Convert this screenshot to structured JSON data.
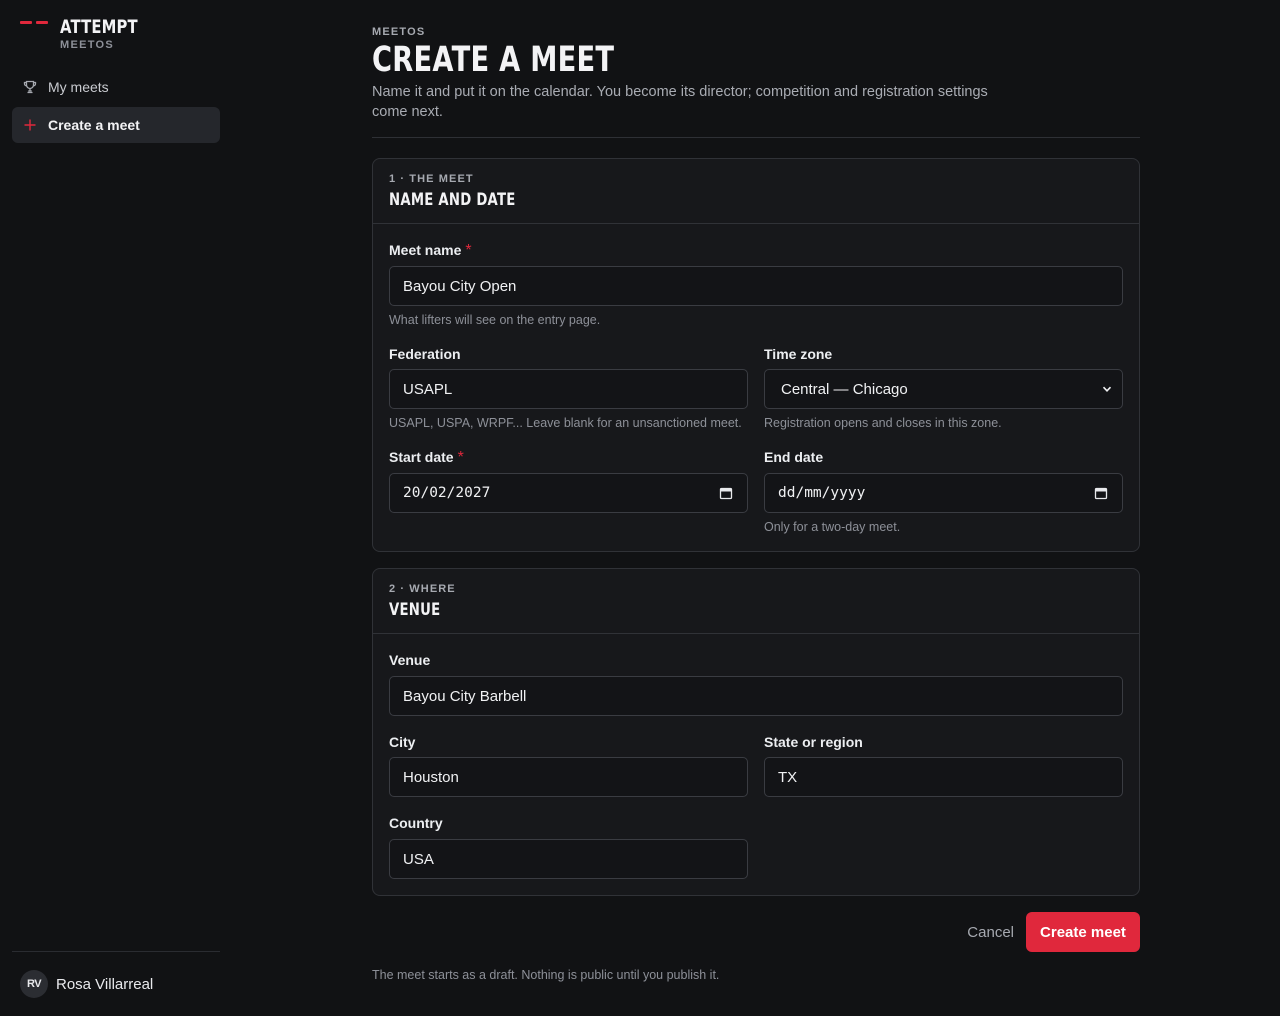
{
  "brand": {
    "name": "ATTEMPT",
    "sub": "MEETOS"
  },
  "nav": {
    "items": [
      {
        "label": "My meets",
        "icon": "trophy-icon",
        "active": false
      },
      {
        "label": "Create a meet",
        "icon": "plus-icon",
        "active": true
      }
    ]
  },
  "user": {
    "initials": "RV",
    "name": "Rosa Villarreal"
  },
  "header": {
    "eyebrow": "MEETOS",
    "title": "CREATE A MEET",
    "intro": "Name it and put it on the calendar. You become its director; competition and registration settings come next."
  },
  "section1": {
    "eyebrow": "1 · THE MEET",
    "title": "NAME AND DATE",
    "meet_name": {
      "label": "Meet name",
      "required": "*",
      "value": "Bayou City Open",
      "hint": "What lifters will see on the entry page."
    },
    "federation": {
      "label": "Federation",
      "value": "USAPL",
      "hint": "USAPL, USPA, WRPF... Leave blank for an unsanctioned meet."
    },
    "timezone": {
      "label": "Time zone",
      "value": "Central — Chicago",
      "hint": "Registration opens and closes in this zone."
    },
    "start_date": {
      "label": "Start date",
      "required": "*",
      "value": "20/02/2027"
    },
    "end_date": {
      "label": "End date",
      "placeholder": "dd/mm/yyyy",
      "hint": "Only for a two-day meet."
    }
  },
  "section2": {
    "eyebrow": "2 · WHERE",
    "title": "VENUE",
    "venue": {
      "label": "Venue",
      "value": "Bayou City Barbell"
    },
    "city": {
      "label": "City",
      "value": "Houston"
    },
    "state": {
      "label": "State or region",
      "value": "TX"
    },
    "country": {
      "label": "Country",
      "value": "USA"
    }
  },
  "actions": {
    "cancel": "Cancel",
    "create": "Create meet"
  },
  "footnote": "The meet starts as a draft. Nothing is public until you publish it.",
  "colors": {
    "accent": "#e0283c",
    "background": "#111214",
    "card": "#17181b",
    "border": "#303237"
  }
}
